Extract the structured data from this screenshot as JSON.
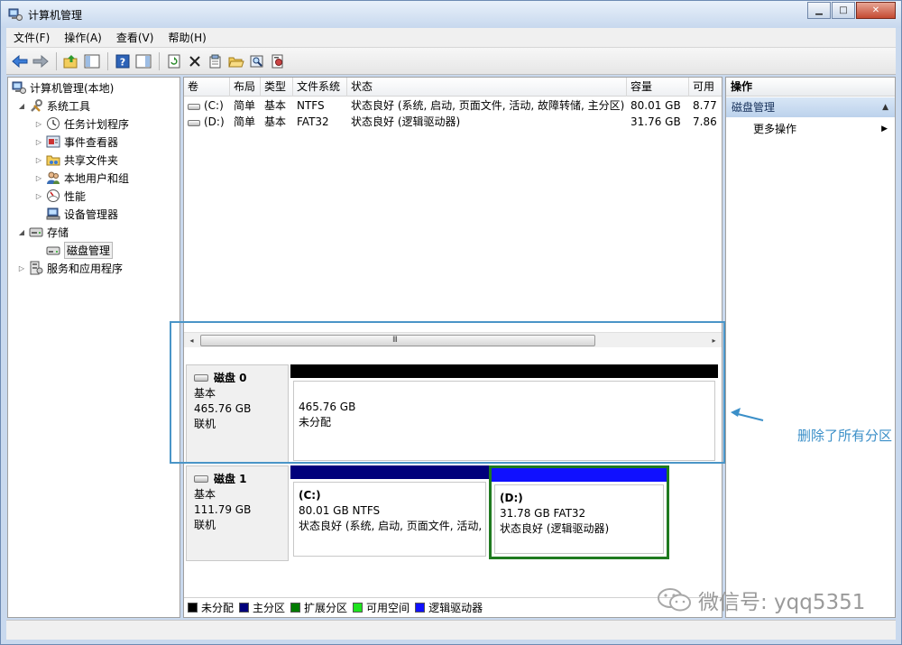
{
  "window": {
    "title": "计算机管理",
    "buttons": {
      "minimize": "▁",
      "maximize": "□",
      "close": "✕"
    }
  },
  "menu": [
    "文件(F)",
    "操作(A)",
    "查看(V)",
    "帮助(H)"
  ],
  "toolbar": [
    "back-icon",
    "forward-icon",
    "up-icon",
    "show-hide-tree-icon",
    "help-icon",
    "show-hide-action-icon",
    "refresh-icon",
    "delete-icon",
    "properties-icon",
    "open-icon",
    "search-icon",
    "settings-icon"
  ],
  "tree": {
    "root": "计算机管理(本地)",
    "system_tools": "系统工具",
    "task_scheduler": "任务计划程序",
    "event_viewer": "事件查看器",
    "shared_folders": "共享文件夹",
    "local_users": "本地用户和组",
    "performance": "性能",
    "device_manager": "设备管理器",
    "storage": "存储",
    "disk_management": "磁盘管理",
    "services": "服务和应用程序"
  },
  "list": {
    "columns": [
      "卷",
      "布局",
      "类型",
      "文件系统",
      "状态",
      "容量",
      "可用"
    ],
    "rows": [
      {
        "volume": "(C:)",
        "layout": "简单",
        "type": "基本",
        "fs": "NTFS",
        "status": "状态良好 (系统, 启动, 页面文件, 活动, 故障转储, 主分区)",
        "capacity": "80.01 GB",
        "free": "8.77"
      },
      {
        "volume": "(D:)",
        "layout": "简单",
        "type": "基本",
        "fs": "FAT32",
        "status": "状态良好 (逻辑驱动器)",
        "capacity": "31.76 GB",
        "free": "7.86"
      }
    ]
  },
  "scrollbar": {
    "left": "◂",
    "right": "▸",
    "grip": "III"
  },
  "disks": [
    {
      "name": "磁盘 0",
      "type": "基本",
      "size": "465.76 GB",
      "state": "联机",
      "volume": {
        "size": "465.76 GB",
        "label": "未分配"
      }
    },
    {
      "name": "磁盘 1",
      "type": "基本",
      "size": "111.79 GB",
      "state": "联机",
      "volumes": [
        {
          "title": "(C:)",
          "detail": "80.01 GB NTFS",
          "status": "状态良好 (系统, 启动, 页面文件, 活动,"
        },
        {
          "title": "(D:)",
          "detail": "31.78 GB FAT32",
          "status": "状态良好 (逻辑驱动器)"
        }
      ]
    }
  ],
  "legend": [
    {
      "label": "未分配",
      "color": "#000000"
    },
    {
      "label": "主分区",
      "color": "#00007b"
    },
    {
      "label": "扩展分区",
      "color": "#007b00"
    },
    {
      "label": "可用空间",
      "color": "#1fe41f"
    },
    {
      "label": "逻辑驱动器",
      "color": "#1010ff"
    }
  ],
  "actions": {
    "header": "操作",
    "section": "磁盘管理",
    "more": "更多操作"
  },
  "annotation": {
    "text": "删除了所有分区"
  },
  "watermark": {
    "text": "微信号: yqq5351"
  }
}
